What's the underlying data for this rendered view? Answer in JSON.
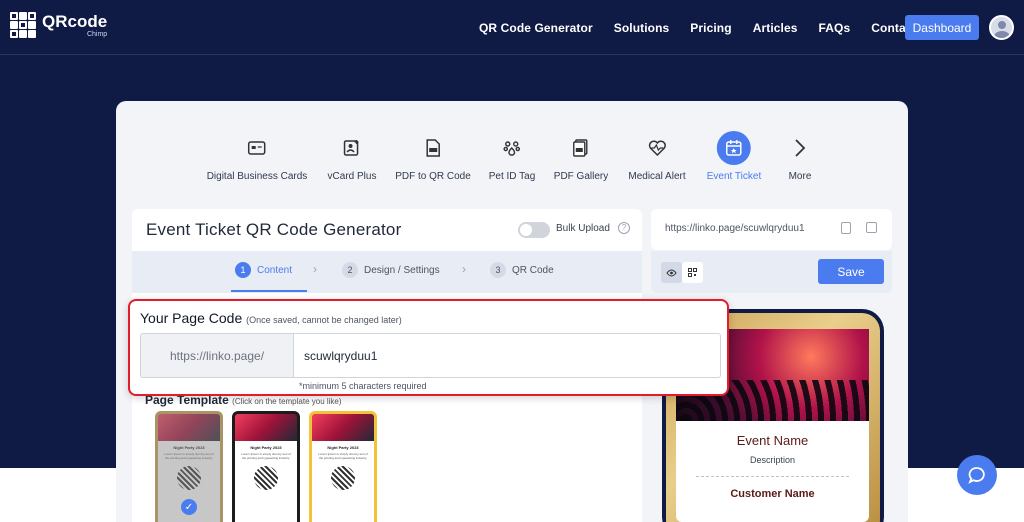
{
  "brand": {
    "name": "QRcode",
    "sub": "Chimp"
  },
  "nav": {
    "links": [
      "QR Code Generator",
      "Solutions",
      "Pricing",
      "Articles",
      "FAQs",
      "Contact Us"
    ],
    "dashboard_label": "Dashboard"
  },
  "qr_types": [
    {
      "label": "Digital Business Cards",
      "icon": "business-card-icon"
    },
    {
      "label": "vCard Plus",
      "icon": "vcard-icon"
    },
    {
      "label": "PDF to QR Code",
      "icon": "pdf-icon"
    },
    {
      "label": "Pet ID Tag",
      "icon": "paw-icon"
    },
    {
      "label": "PDF Gallery",
      "icon": "pdf-gallery-icon"
    },
    {
      "label": "Medical Alert",
      "icon": "heartbeat-icon"
    },
    {
      "label": "Event Ticket",
      "icon": "calendar-icon",
      "active": true
    },
    {
      "label": "More",
      "icon": "chevron-right-icon"
    }
  ],
  "generator": {
    "title": "Event Ticket QR Code Generator",
    "bulk_upload_label": "Bulk Upload",
    "help_glyph": "?"
  },
  "steps": [
    {
      "num": "1",
      "label": "Content",
      "active": true
    },
    {
      "num": "2",
      "label": "Design / Settings"
    },
    {
      "num": "3",
      "label": "QR Code"
    }
  ],
  "page_code": {
    "title": "Your Page Code",
    "note": "(Once saved, cannot be changed later)",
    "prefix": "https://linko.page/",
    "value": "scuwlqryduu1",
    "hint": "*minimum 5 characters required"
  },
  "templates": {
    "title": "Page Template",
    "note": "(Click on the template you like)",
    "items": [
      {
        "name": "Night Party 2023",
        "desc": "Lorem Ipsum is simply dummy text of the printing and typesetting industry.",
        "frame": "#c9a24d",
        "selected": true
      },
      {
        "name": "Night Party 2023",
        "desc": "Lorem Ipsum is simply dummy text of the printing and typesetting industry.",
        "frame": "#1c1c1c"
      },
      {
        "name": "Night Party 2023",
        "desc": "Lorem Ipsum is simply dummy text of the printing and typesetting industry.",
        "frame": "#f2c337"
      }
    ]
  },
  "preview": {
    "url": "https://linko.page/scuwlqryduu1",
    "save_label": "Save",
    "event_name": "Event Name",
    "description": "Description",
    "customer_name": "Customer Name"
  },
  "colors": {
    "accent": "#4a7cf0",
    "navy": "#0f1a45",
    "alert_border": "#e11d2b"
  }
}
